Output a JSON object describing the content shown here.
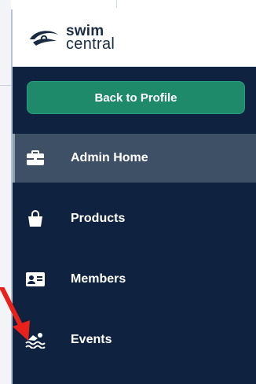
{
  "brand": {
    "line1": "swim",
    "line2": "central",
    "logo_icon": "swim-central-logo"
  },
  "back_button": {
    "label": "Back to Profile"
  },
  "nav": {
    "items": [
      {
        "label": "Admin Home",
        "icon": "briefcase-icon",
        "active": true
      },
      {
        "label": "Products",
        "icon": "shopping-bag-icon",
        "active": false
      },
      {
        "label": "Members",
        "icon": "id-card-icon",
        "active": false
      },
      {
        "label": "Events",
        "icon": "swimmer-icon",
        "active": false
      }
    ]
  },
  "colors": {
    "sidebar_bg": "#0f2340",
    "active_bg": "#3e5066",
    "button_green": "#1e8a6a",
    "annotation_arrow": "#e8221b"
  }
}
